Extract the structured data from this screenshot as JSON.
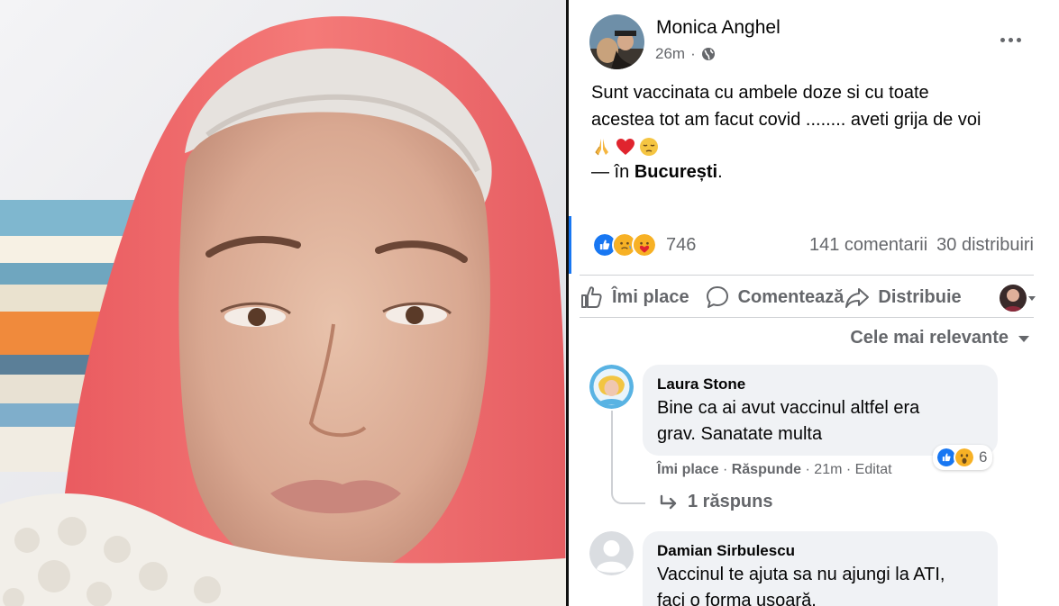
{
  "photo": {
    "alt": "selfie"
  },
  "post": {
    "author": "Monica Anghel",
    "time": "26m",
    "privacy_icon": "globe-icon",
    "text_lines": [
      "Sunt vaccinata cu ambele doze si cu toate",
      "acestea tot am facut covid ........ aveti grija de voi"
    ],
    "emojis": [
      "praying-hands",
      "red-heart",
      "pensive-face"
    ],
    "location_prefix": "— în",
    "location": "București",
    "location_suffix": "."
  },
  "reactions": {
    "types": [
      "like",
      "care",
      "love-face"
    ],
    "count": "746",
    "comments": "141 comentarii",
    "shares": "30 distribuiri"
  },
  "actions": {
    "like": "Îmi place",
    "comment": "Comentează",
    "share": "Distribuie"
  },
  "sort_label": "Cele mai relevante",
  "comments": [
    {
      "name": "Laura Stone",
      "text_lines": [
        "Bine ca ai avut vaccinul altfel era",
        "grav. Sanatate multa"
      ],
      "reaction_count": "6",
      "like": "Îmi place",
      "reply": "Răspunde",
      "time": "21m",
      "edited": "Editat",
      "replies": "1 răspuns"
    },
    {
      "name": "Damian Sirbulescu",
      "text_lines": [
        "Vaccinul te ajuta sa nu ajungi la ATI,",
        "faci o forma usoară."
      ]
    }
  ],
  "colors": {
    "accent": "#1877f2",
    "secondary_text": "#65676b",
    "bubble": "#f0f2f5",
    "scarf": "#f26b6b"
  }
}
